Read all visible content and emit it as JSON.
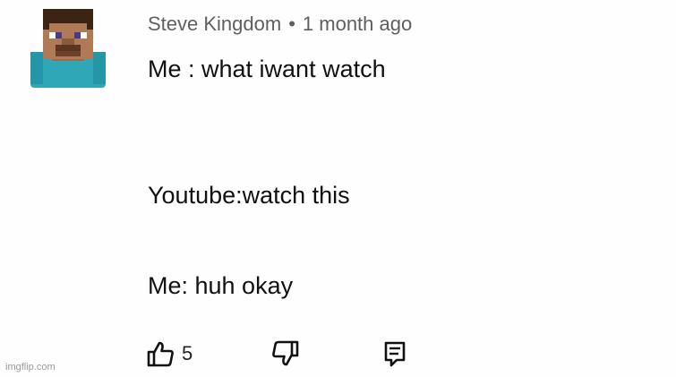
{
  "comment": {
    "author": "Steve Kingdom",
    "separator": "•",
    "timestamp": "1 month ago",
    "lines": [
      "Me : what iwant watch",
      "Youtube:watch this",
      "Me: huh okay"
    ]
  },
  "actions": {
    "like_icon": "thumbs-up-icon",
    "like_count": "5",
    "dislike_icon": "thumbs-down-icon",
    "reply_icon": "reply-comment-icon"
  },
  "avatar": {
    "icon": "minecraft-steve-avatar",
    "colors": {
      "hair": "#3b2414",
      "skin": "#b07a57",
      "shirt": "#2fa7b7",
      "eyes": "#ffffff",
      "pupils": "#4a3a8a"
    }
  },
  "watermark": "imgflip.com",
  "colors": {
    "background": "#fefefe",
    "meta_text": "#5f5f5f",
    "body_text": "#111111"
  }
}
